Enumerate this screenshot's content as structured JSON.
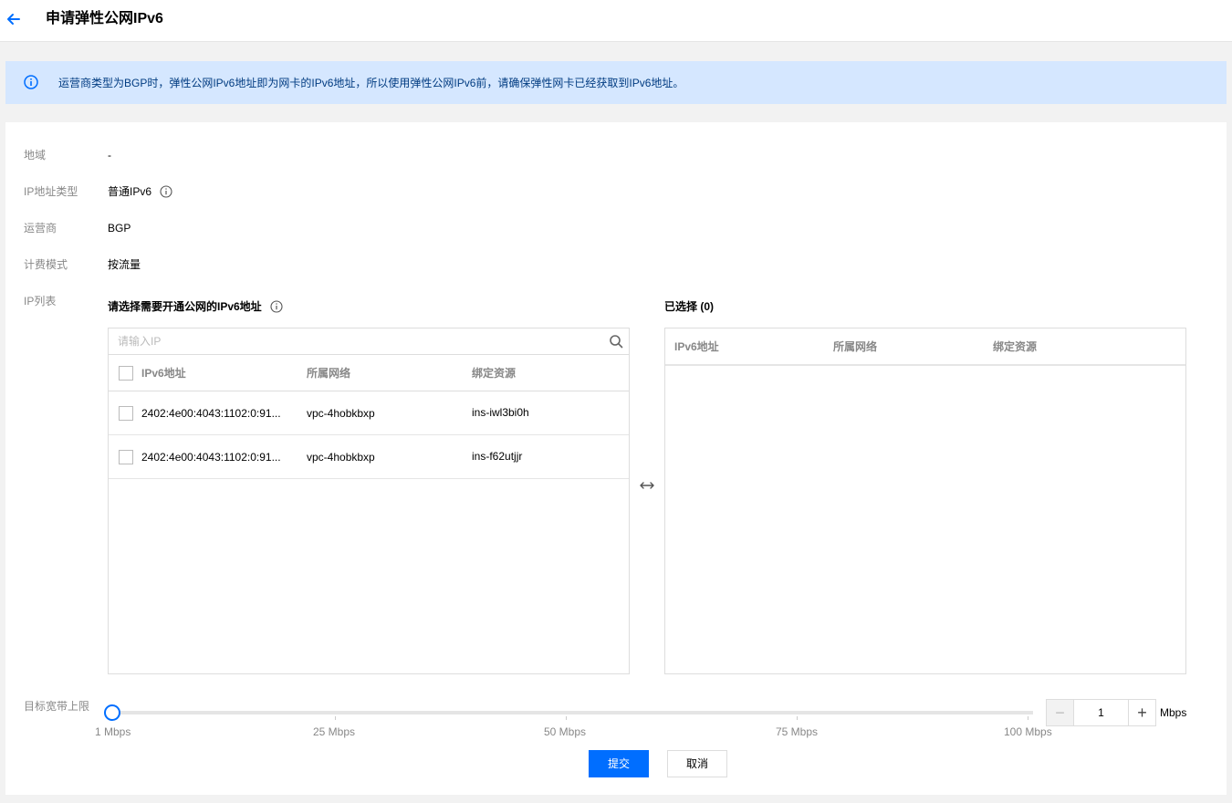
{
  "header": {
    "title": "申请弹性公网IPv6",
    "back_icon": "arrow-left-icon"
  },
  "notice": {
    "icon": "info-icon",
    "text": "运营商类型为BGP时，弹性公网IPv6地址即为网卡的IPv6地址，所以使用弹性公网IPv6前，请确保弹性网卡已经获取到IPv6地址。"
  },
  "form": {
    "region": {
      "label": "地域",
      "value": "-"
    },
    "ip_type": {
      "label": "IP地址类型",
      "value": "普通IPv6",
      "icon": "info-icon"
    },
    "isp": {
      "label": "运营商",
      "value": "BGP"
    },
    "billing": {
      "label": "计费模式",
      "value": "按流量"
    },
    "ip_list": {
      "label": "IP列表"
    }
  },
  "source_panel": {
    "title": "请选择需要开通公网的IPv6地址",
    "search_placeholder": "请输入IP",
    "columns": [
      "IPv6地址",
      "所属网络",
      "绑定资源"
    ],
    "rows": [
      {
        "ipv6": "2402:4e00:4043:1102:0:91...",
        "network": "vpc-4hobkbxp",
        "resource": "ins-iwl3bi0h",
        "checked": false
      },
      {
        "ipv6": "2402:4e00:4043:1102:0:91...",
        "network": "vpc-4hobkbxp",
        "resource": "ins-f62utjjr",
        "checked": false
      }
    ]
  },
  "selected_panel": {
    "title": "已选择 (0)",
    "columns": [
      "IPv6地址",
      "所属网络",
      "绑定资源"
    ]
  },
  "bandwidth": {
    "label": "目标宽带上限",
    "min": 1,
    "max": 100,
    "value": 1,
    "ticks": [
      "1 Mbps",
      "25 Mbps",
      "50 Mbps",
      "75 Mbps",
      "100 Mbps"
    ],
    "stepper_value": "1",
    "unit": "Mbps",
    "minus": "−",
    "plus": "+"
  },
  "actions": {
    "submit": "提交",
    "cancel": "取消"
  },
  "colors": {
    "primary": "#006eff",
    "notice_bg": "#d5e7ff",
    "notice_text": "#003b80"
  }
}
